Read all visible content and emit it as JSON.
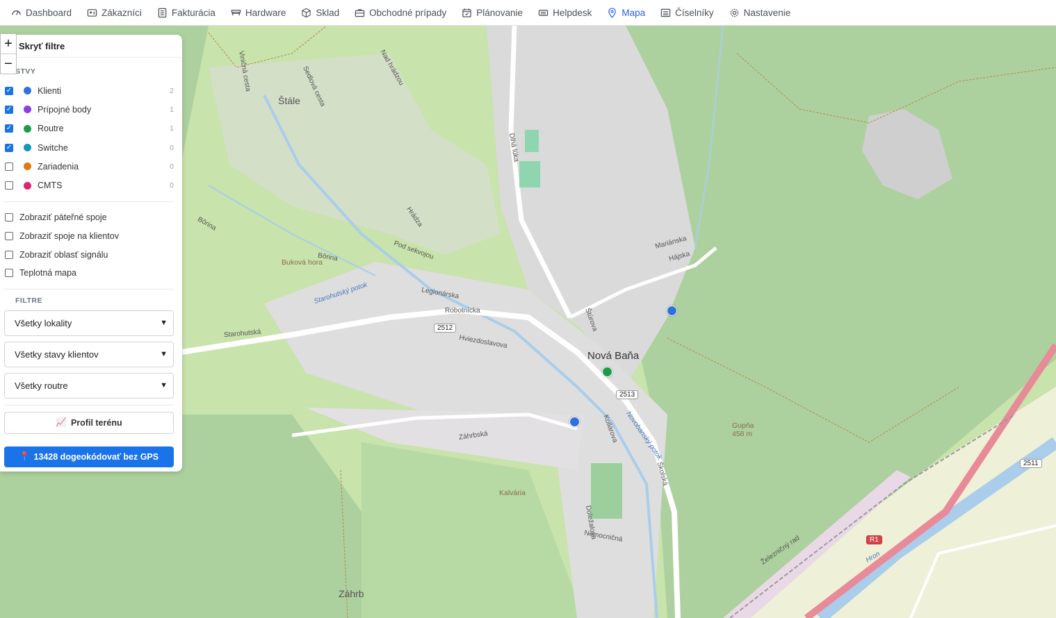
{
  "nav": {
    "items": [
      {
        "label": "Dashboard",
        "icon": "dashboard-icon"
      },
      {
        "label": "Zákazníci",
        "icon": "customers-icon"
      },
      {
        "label": "Fakturácia",
        "icon": "invoice-icon"
      },
      {
        "label": "Hardware",
        "icon": "hardware-icon"
      },
      {
        "label": "Sklad",
        "icon": "box-icon"
      },
      {
        "label": "Obchodné prípady",
        "icon": "briefcase-icon"
      },
      {
        "label": "Plánovanie",
        "icon": "calendar-icon"
      },
      {
        "label": "Helpdesk",
        "icon": "ticket-icon"
      },
      {
        "label": "Mapa",
        "icon": "map-pin-icon"
      },
      {
        "label": "Číselníky",
        "icon": "list-icon"
      },
      {
        "label": "Nastavenie",
        "icon": "gear-icon"
      }
    ],
    "active": "Mapa",
    "active_color": "#2563eb"
  },
  "panel": {
    "hide_label": "Skryť filtre",
    "layers_title": "STVY",
    "layers": [
      {
        "label": "Klienti",
        "color": "#2f6fe0",
        "count": "2",
        "checked": true
      },
      {
        "label": "Prípojné body",
        "color": "#8b3fe0",
        "count": "1",
        "checked": true
      },
      {
        "label": "Routre",
        "color": "#1e9a4a",
        "count": "1",
        "checked": true
      },
      {
        "label": "Switche",
        "color": "#1496b8",
        "count": "0",
        "checked": true
      },
      {
        "label": "Zariadenia",
        "color": "#e07a10",
        "count": "0",
        "checked": false
      },
      {
        "label": "CMTS",
        "color": "#e0236e",
        "count": "0",
        "checked": false
      }
    ],
    "options": [
      {
        "label": "Zobraziť páteřné spoje"
      },
      {
        "label": "Zobraziť spoje na klientov"
      },
      {
        "label": "Zobraziť oblasť signálu"
      },
      {
        "label": "Teplotná mapa"
      }
    ],
    "filters_title": "FILTRE",
    "selects": [
      {
        "value": "Všetky lokality"
      },
      {
        "value": "Všetky stavy klientov"
      },
      {
        "value": "Všetky routre"
      }
    ],
    "profile_button": "Profil terénu",
    "profile_icon": "📈",
    "geocode_button": "13428 dogeokódovať bez GPS",
    "geocode_icon": "📍"
  },
  "zoom": {
    "in": "+",
    "out": "−"
  },
  "map": {
    "labels": {
      "town": "Nová Baňa",
      "stale": "Štále",
      "zahrb": "Záhrb",
      "bukova": "Buková hora",
      "kalvaria": "Kalvária",
      "gupna": "Gupňa",
      "gupna_alt": "458 m",
      "hron": "Hron",
      "starohutsky": "Starohutský potok",
      "novobansky": "Novobanský potok",
      "starohutska": "Starohutská",
      "borina": "Bôrina",
      "borina2": "Bôrina",
      "hviezdoslavova": "Hviezdoslavova",
      "zahrbska": "Záhrbská",
      "skolska": "Školská",
      "hajska": "Hájska",
      "marianska": "Mariánska",
      "dlha_luka": "Dlhá lúka",
      "robotnicka": "Robotnícka",
      "legionarska": "Legionárska",
      "sturova": "Štúrova",
      "kollarova": "Kollárova",
      "zeleznicny": "Železničný rad",
      "nad_hradzou": "Nad hrádzou",
      "sedlova": "Sedlová cesta",
      "vinicna": "Viničná cesta",
      "dolezalova": "Doležalova",
      "nemocnicna": "Nemocničná",
      "podsekvojou": "Pod sekvojou",
      "hradza": "Hrádza"
    },
    "shields": {
      "s2512": "2512",
      "s2513": "2513",
      "s2511": "2511",
      "r1": "R1"
    },
    "markers": [
      {
        "name": "client-marker-east",
        "color": "#2f6fe0"
      },
      {
        "name": "router-marker-center",
        "color": "#1e9a4a"
      },
      {
        "name": "client-marker-south",
        "color": "#2f6fe0"
      }
    ]
  }
}
